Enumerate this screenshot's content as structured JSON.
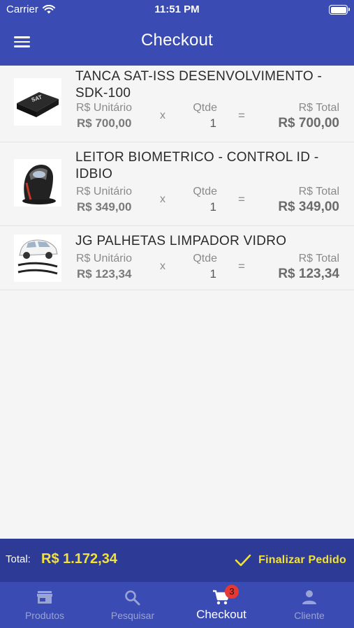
{
  "status_bar": {
    "carrier": "Carrier",
    "time": "11:51 PM"
  },
  "header": {
    "title": "Checkout"
  },
  "labels": {
    "unit_price": "R$ Unitário",
    "times": "x",
    "quantity": "Qtde",
    "equals": "=",
    "total": "R$ Total"
  },
  "items": [
    {
      "name": "TANCA SAT-ISS DESENVOLVIMENTO - SDK-100",
      "unit_price": "R$ 700,00",
      "qty": "1",
      "total": "R$ 700,00",
      "icon": "sat-device-image"
    },
    {
      "name": "LEITOR BIOMETRICO - CONTROL ID - IDBIO",
      "unit_price": "R$ 349,00",
      "qty": "1",
      "total": "R$ 349,00",
      "icon": "biometric-reader-image"
    },
    {
      "name": "JG PALHETAS LIMPADOR VIDRO",
      "unit_price": "R$ 123,34",
      "qty": "1",
      "total": "R$ 123,34",
      "icon": "wiper-blades-image"
    }
  ],
  "footer": {
    "total_label": "Total:",
    "total_value": "R$ 1.172,34",
    "finalize_label": "Finalizar Pedido"
  },
  "tabs": [
    {
      "label": "Produtos",
      "icon": "store-icon"
    },
    {
      "label": "Pesquisar",
      "icon": "search-icon"
    },
    {
      "label": "Checkout",
      "icon": "cart-icon",
      "badge": "3",
      "active": true
    },
    {
      "label": "Cliente",
      "icon": "person-icon"
    }
  ],
  "colors": {
    "primary": "#3a4bb3",
    "footer": "#2d3a96",
    "accent": "#f2e23a",
    "badge": "#e53935"
  }
}
